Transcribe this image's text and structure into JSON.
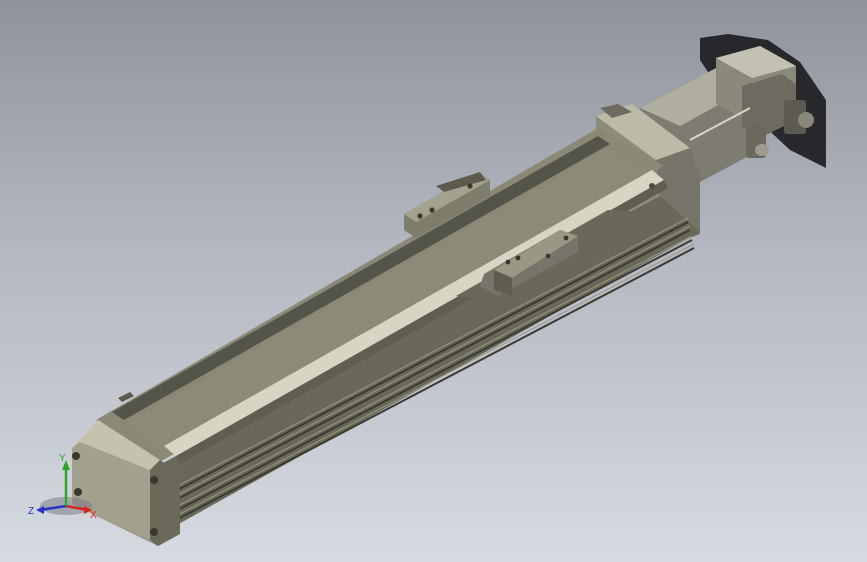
{
  "viewport": {
    "background_top": "#8f949c",
    "background_bottom": "#d6dae1"
  },
  "model": {
    "body_color": "#8d8b77",
    "body_dark": "#5c5b4d",
    "body_light": "#b4b29e",
    "motor_color": "#88867a",
    "shadow_color": "#1e1e22"
  },
  "triad": {
    "x_label": "X",
    "y_label": "Y",
    "z_label": "Z",
    "x_color": "#d7261e",
    "y_color": "#2fa52f",
    "z_color": "#2433c8"
  }
}
